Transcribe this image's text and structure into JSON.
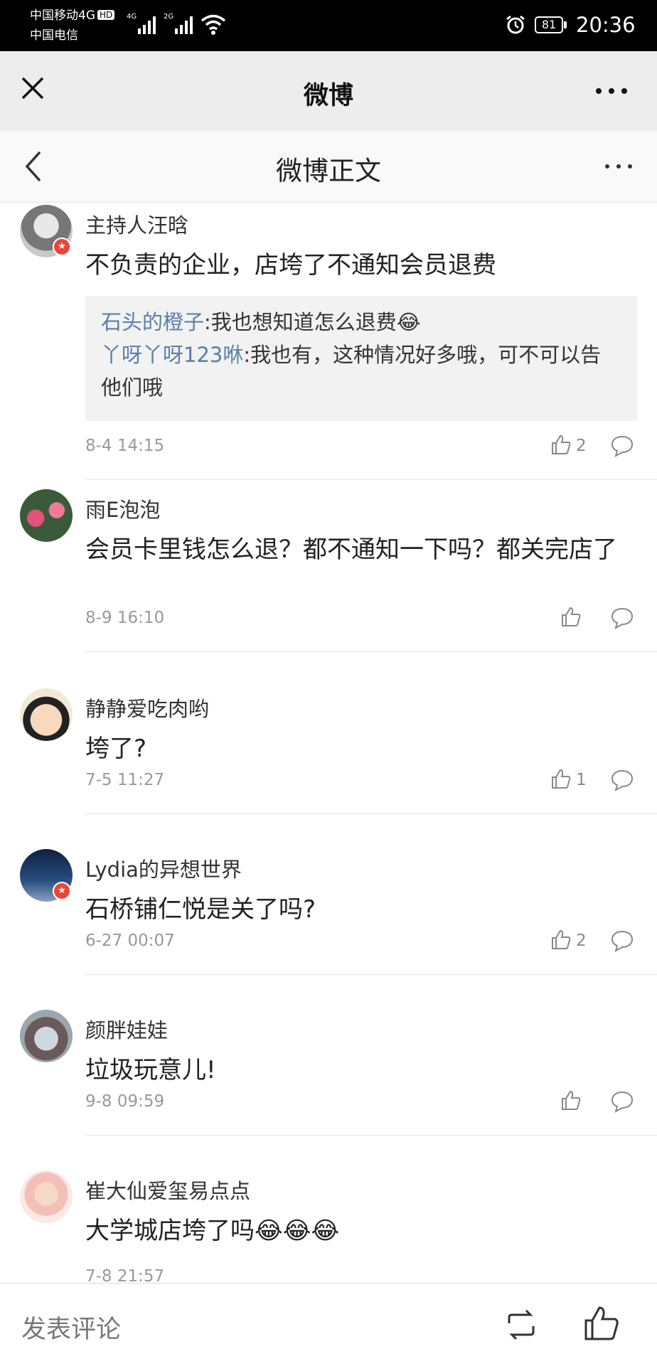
{
  "status_bar": {
    "carrier1": "中国移动4G",
    "hd": "HD",
    "carrier2": "中国电信",
    "net1": "4G",
    "net2": "2G",
    "battery": "81",
    "time": "20:36"
  },
  "top_bar": {
    "title": "微博"
  },
  "sub_bar": {
    "title": "微博正文"
  },
  "comments": [
    {
      "username": "主持人汪晗",
      "content": "不负责的企业，店垮了不通知会员退费",
      "verified": true,
      "replies": [
        {
          "name": "石头的橙子",
          "text": ":我也想知道怎么退费😂"
        },
        {
          "name": "丫呀丫呀123咻",
          "text": ":我也有，这种情况好多哦，可不可以告他们哦"
        }
      ],
      "time": "8-4 14:15",
      "likes": "2"
    },
    {
      "username": "雨E泡泡",
      "content": "会员卡里钱怎么退？都不通知一下吗？都关完店了",
      "verified": false,
      "time": "8-9 16:10",
      "likes": ""
    },
    {
      "username": "静静爱吃肉哟",
      "content": "垮了?",
      "verified": false,
      "time": "7-5 11:27",
      "likes": "1"
    },
    {
      "username": "Lydia的异想世界",
      "content": "石桥铺仁悦是关了吗?",
      "verified": true,
      "time": "6-27 00:07",
      "likes": "2"
    },
    {
      "username": "颜胖娃娃",
      "content": "垃圾玩意儿!",
      "verified": false,
      "time": "9-8 09:59",
      "likes": ""
    },
    {
      "username": "崔大仙爱玺易点点",
      "content": "大学城店垮了吗😂😂😂",
      "verified": false,
      "time": "7-8 21:57",
      "likes": ""
    }
  ],
  "bottom_bar": {
    "comment_placeholder": "发表评论"
  },
  "colors": {
    "accent_link": "#5b7ea8",
    "verified_badge": "#e8463a",
    "header_bg": "#ededed"
  },
  "icons": [
    "close-icon",
    "more-icon",
    "back-icon",
    "like-icon",
    "reply-icon",
    "repost-icon",
    "alarm-icon",
    "wifi-icon",
    "signal-icon"
  ]
}
